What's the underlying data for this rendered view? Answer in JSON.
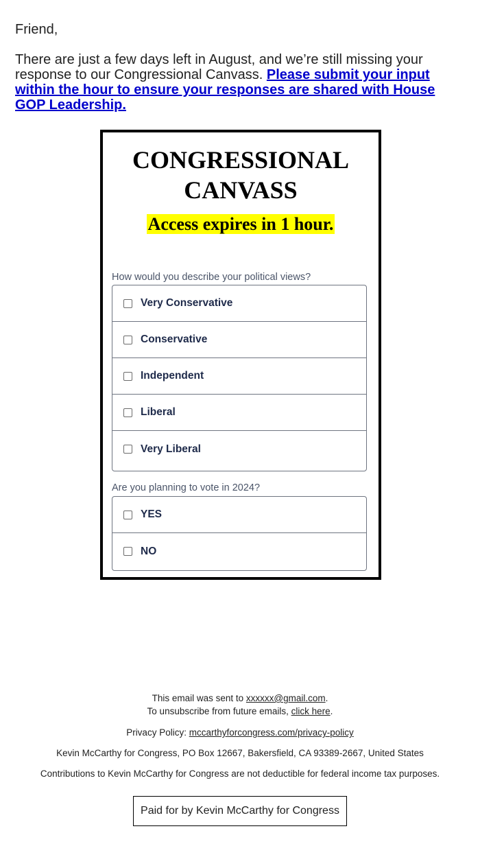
{
  "intro": {
    "greeting": "Friend,",
    "body_text": "There are just a few days left in August, and we’re still missing your response to our Congressional Canvass. ",
    "link_text": "Please submit your input within the hour to ensure your responses are shared with House GOP Leadership."
  },
  "card": {
    "title": "CONGRESSIONAL CANVASS",
    "expires_text": "Access expires in 1 hour.",
    "highlight_color": "#ffff00",
    "questions": [
      {
        "prompt": "How would you describe your political views?",
        "options": [
          "Very Conservative",
          "Conservative",
          "Independent",
          "Liberal",
          "Very Liberal"
        ]
      },
      {
        "prompt": "Are you planning to vote in 2024?",
        "options": [
          "YES",
          "NO"
        ]
      }
    ]
  },
  "footer": {
    "sent_prefix": "This email was sent to ",
    "sent_email": "xxxxxx@gmail.com",
    "sent_suffix": ".",
    "unsub_prefix": "To unsubscribe from future emails, ",
    "unsub_link": "click here",
    "unsub_suffix": ".",
    "privacy_prefix": "Privacy Policy: ",
    "privacy_link": "mccarthyforcongress.com/privacy-policy",
    "address": "Kevin McCarthy for Congress, PO Box 12667, Bakersfield, CA 93389-2667, United States",
    "disclaimer": "Contributions to Kevin McCarthy for Congress are not deductible for federal income tax purposes.",
    "paid_for": "Paid for by Kevin McCarthy for Congress"
  }
}
